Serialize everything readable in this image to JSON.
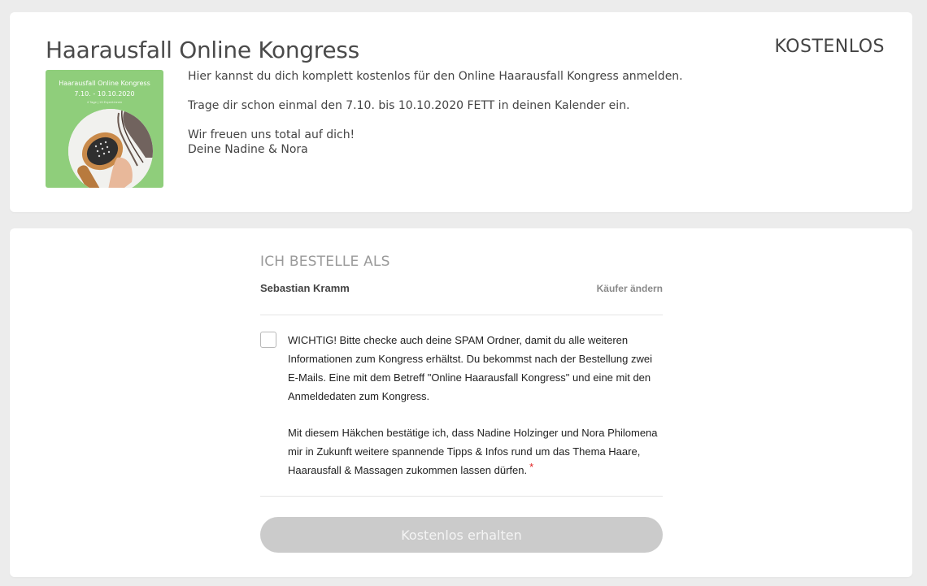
{
  "product": {
    "title": "Haarausfall Online Kongress",
    "price_label": "KOSTENLOS",
    "thumbnail": {
      "title": "Haarausfall Online Kongress",
      "dates": "7.10. - 10.10.2020",
      "subtitle": "4 Tage | 15 Expert:innen",
      "background_color": "#8fce7b"
    },
    "description": [
      "Hier kannst du dich komplett kostenlos für den Online Haarausfall Kongress anmelden.",
      "Trage dir schon einmal den 7.10. bis 10.10.2020 FETT in deinen Kalender ein."
    ],
    "closing_line1": "Wir freuen uns total auf dich!",
    "closing_line2": "Deine Nadine & Nora"
  },
  "order": {
    "section_title": "ICH BESTELLE ALS",
    "buyer_name": "Sebastian Kramm",
    "change_buyer_label": "Käufer ändern",
    "consent_paragraph1": "WICHTIG! Bitte checke auch deine SPAM Ordner, damit du alle weiteren Informationen zum Kongress erhältst. Du bekommst nach der Bestellung zwei E-Mails. Eine mit dem Betreff \"Online Haarausfall Kongress\" und eine mit den Anmeldedaten zum Kongress.",
    "consent_paragraph2": "Mit diesem Häkchen bestätige ich, dass Nadine Holzinger und Nora Philomena mir in Zukunft weitere spannende Tipps & Infos rund um das Thema Haare, Haarausfall & Massagen zukommen lassen dürfen.",
    "required_marker": "*",
    "checkbox_checked": false,
    "submit_label": "Kostenlos erhalten",
    "submit_enabled": false
  }
}
